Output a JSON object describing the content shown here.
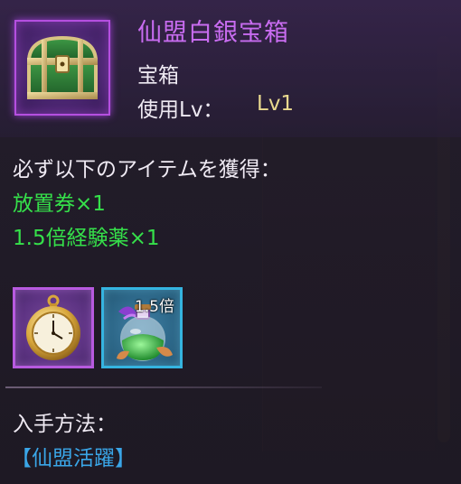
{
  "item": {
    "title": "仙盟白銀宝箱",
    "type": "宝箱",
    "level_label": "使用Lv：",
    "level_value": "Lv1",
    "icon": "treasure-chest-icon",
    "frame_color": "#b54fe0"
  },
  "description": "必ず以下のアイテムを獲得：",
  "rewards": [
    {
      "label": "放置券×1",
      "icon": "pocket-watch-icon",
      "slot_color": "#b75adf"
    },
    {
      "label": "1.5倍経験薬×1",
      "icon": "exp-potion-icon",
      "slot_color": "#35b4e0",
      "badge": "1.5倍"
    }
  ],
  "source": {
    "label": "入手方法：",
    "value": "【仙盟活躍】"
  },
  "colors": {
    "title": "#c86cf0",
    "reward_text": "#35e04a",
    "level_value": "#e9d98f",
    "source_value": "#3aa6e8"
  }
}
